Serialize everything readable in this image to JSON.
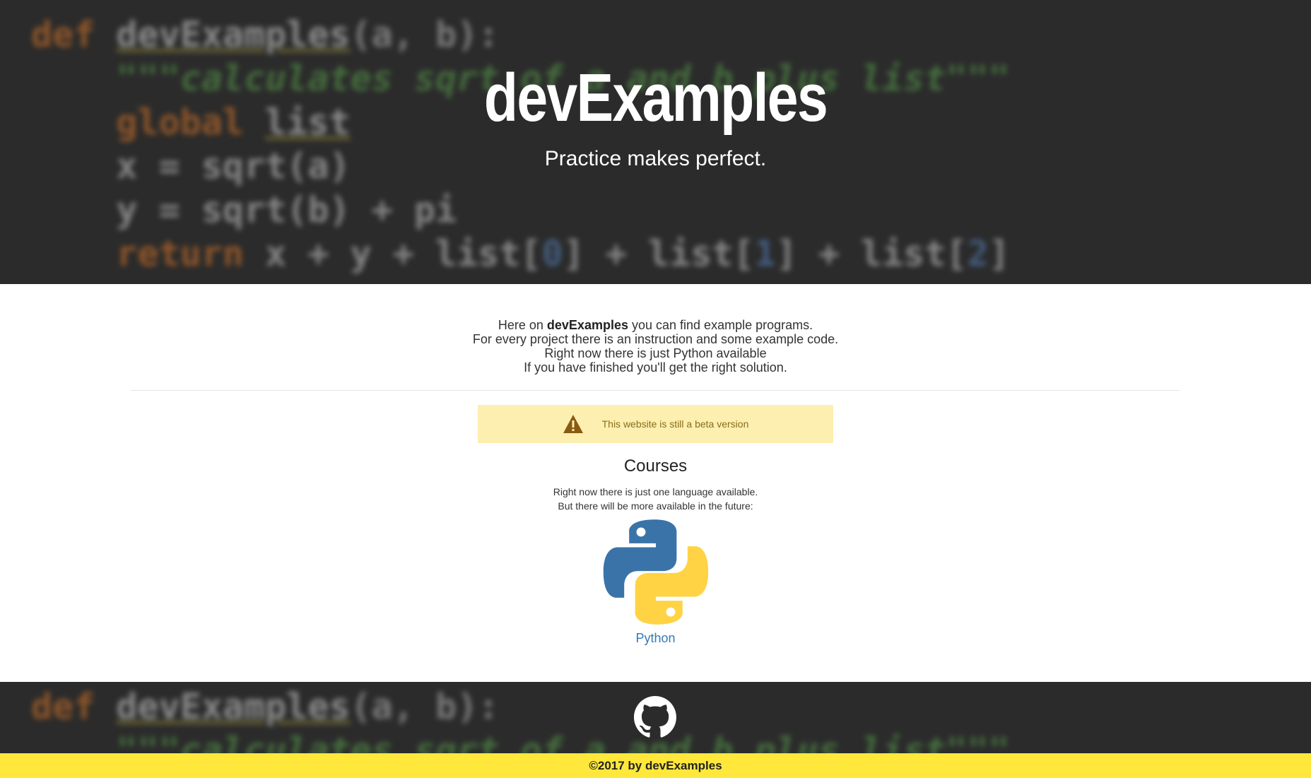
{
  "hero": {
    "title": "devExamples",
    "subtitle": "Practice makes perfect.",
    "code_background": [
      [
        {
          "t": "def ",
          "c": "kw"
        },
        {
          "t": "devExamples",
          "c": "fn"
        },
        {
          "t": "(a, b):",
          "c": "par"
        }
      ],
      [
        {
          "t": "    \"\"\"calculates sqrt of a and b plus list\"\"\"",
          "c": "str"
        }
      ],
      [
        {
          "t": "    global ",
          "c": "kw"
        },
        {
          "t": "list",
          "c": "fn"
        }
      ],
      [
        {
          "t": "    x = sqrt(a)",
          "c": "plain"
        }
      ],
      [
        {
          "t": "    y = sqrt(b) + pi",
          "c": "plain"
        }
      ],
      [
        {
          "t": "    return ",
          "c": "kw"
        },
        {
          "t": "x + y + list[",
          "c": "plain"
        },
        {
          "t": "0",
          "c": "num"
        },
        {
          "t": "] + list[",
          "c": "plain"
        },
        {
          "t": "1",
          "c": "num"
        },
        {
          "t": "] + list[",
          "c": "plain"
        },
        {
          "t": "2",
          "c": "num"
        },
        {
          "t": "]",
          "c": "plain"
        }
      ]
    ]
  },
  "intro": {
    "line1_prefix": "Here on ",
    "line1_brand": "devExamples",
    "line1_suffix": " you can find example programs.",
    "line2": "For every project there is an instruction and some example code.",
    "line3": "Right now there is just Python available",
    "line4": "If you have finished you'll get the right solution."
  },
  "alert": {
    "icon": "warning-icon",
    "text": "This website is still a beta version",
    "bg_color": "#fcefb0",
    "text_color": "#8a6d1a"
  },
  "courses": {
    "title": "Courses",
    "desc_line1": "Right now there is just one language available.",
    "desc_line2": "But there will be more available in the future:",
    "items": [
      {
        "label": "Python",
        "icon": "python-logo-icon",
        "link_color": "#337ab7"
      }
    ]
  },
  "footer": {
    "github_icon": "github-icon",
    "copyright": "©2017 by devExamples",
    "bar_color": "#ffe83b",
    "code_background": [
      [
        {
          "t": "def ",
          "c": "kw"
        },
        {
          "t": "devExamples",
          "c": "fn"
        },
        {
          "t": "(a, b):",
          "c": "par"
        }
      ],
      [
        {
          "t": "    \"\"\"calculates sqrt of a and b plus list\"\"\"",
          "c": "str"
        }
      ]
    ]
  }
}
